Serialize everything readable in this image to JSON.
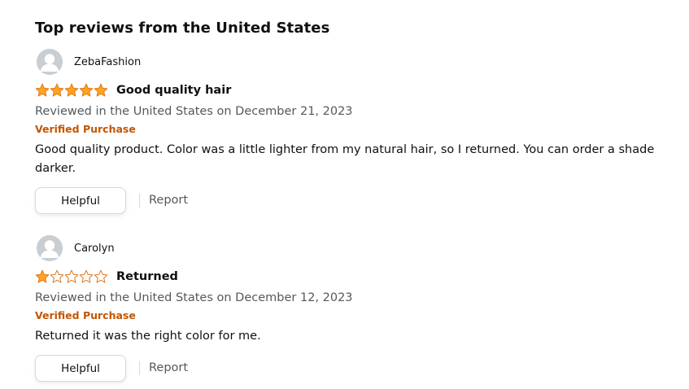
{
  "section": {
    "title": "Top reviews from the United States"
  },
  "colors": {
    "star_fill": "#ffa41c",
    "star_stroke": "#de7921",
    "verified": "#c45500"
  },
  "reviews": [
    {
      "profile_name": "ZebaFashion",
      "avatar_icon": "user-silhouette-icon",
      "rating": 5,
      "rating_max": 5,
      "title": "Good quality hair",
      "date": "Reviewed in the United States on December 21, 2023",
      "verified": "Verified Purchase",
      "body": "Good quality product. Color was a little lighter from my natural hair, so I returned. You can order a shade darker.",
      "helpful_label": "Helpful",
      "report_label": "Report"
    },
    {
      "profile_name": "Carolyn",
      "avatar_icon": "user-silhouette-icon",
      "rating": 1,
      "rating_max": 5,
      "title": "Returned",
      "date": "Reviewed in the United States on December 12, 2023",
      "verified": "Verified Purchase",
      "body": "Returned it was the right color for me.",
      "helpful_label": "Helpful",
      "report_label": "Report"
    }
  ]
}
